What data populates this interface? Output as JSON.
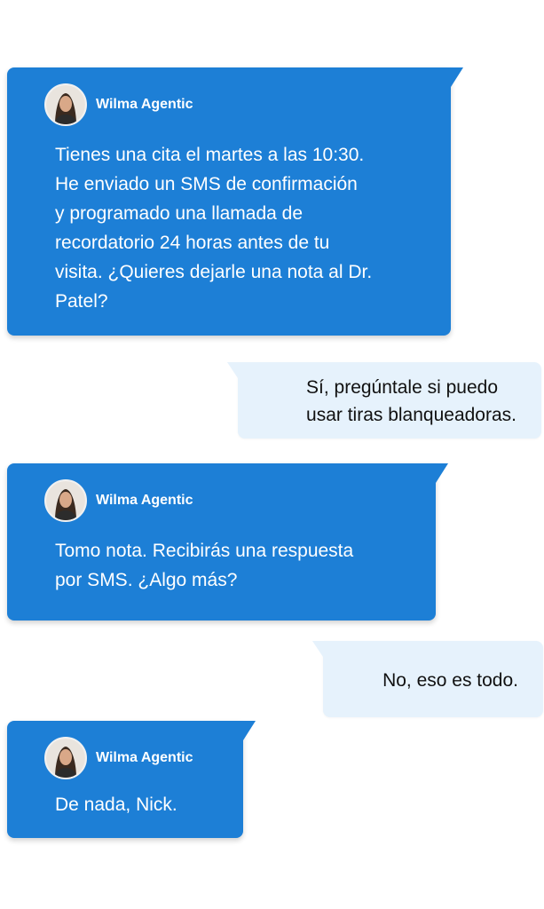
{
  "colors": {
    "agent_bubble": "#1d7fd6",
    "user_bubble": "#e6f2fc",
    "agent_text": "#ffffff",
    "user_text": "#111111"
  },
  "messages": [
    {
      "sender": "agent",
      "name": "Wilma Agentic",
      "avatar": "woman-portrait-avatar",
      "text": "Tienes una cita el martes a las 10:30.\nHe enviado un SMS de confirmación\ny programado una llamada de\nrecordatorio 24 horas antes de tu\nvisita. ¿Quieres dejarle una nota al Dr.\nPatel?"
    },
    {
      "sender": "user",
      "text": "Sí, pregúntale si puedo\nusar tiras blanqueadoras."
    },
    {
      "sender": "agent",
      "name": "Wilma Agentic",
      "avatar": "woman-portrait-avatar",
      "text": "Tomo nota. Recibirás una respuesta\npor SMS. ¿Algo más?"
    },
    {
      "sender": "user",
      "text": "No, eso es todo."
    },
    {
      "sender": "agent",
      "name": "Wilma Agentic",
      "avatar": "woman-portrait-avatar",
      "text": "De nada, Nick."
    }
  ]
}
